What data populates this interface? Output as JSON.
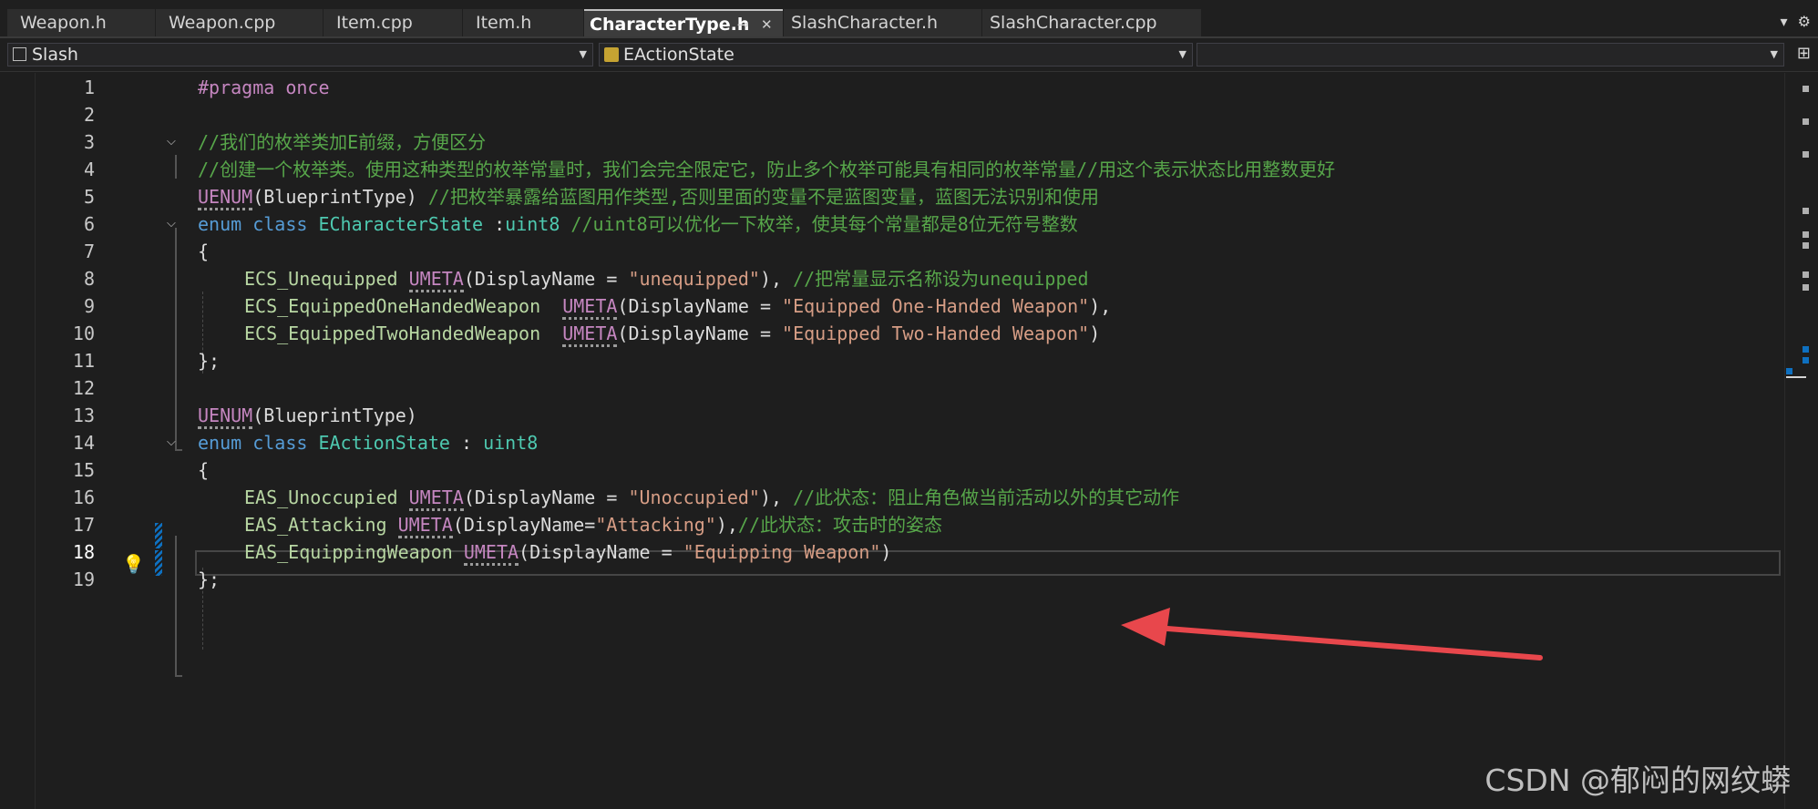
{
  "tabs": [
    {
      "label": "Weapon.h",
      "active": false
    },
    {
      "label": "Weapon.cpp",
      "active": false
    },
    {
      "label": "Item.cpp",
      "active": false
    },
    {
      "label": "Item.h",
      "active": false
    },
    {
      "label": "CharacterType.h",
      "active": true
    },
    {
      "label": "SlashCharacter.h",
      "active": false
    },
    {
      "label": "SlashCharacter.cpp",
      "active": false
    }
  ],
  "navbar": {
    "project": "Slash",
    "scope": "EActionState",
    "member": ""
  },
  "editor": {
    "current_line": 18,
    "line_numbers": [
      "1",
      "2",
      "3",
      "4",
      "5",
      "6",
      "7",
      "8",
      "9",
      "10",
      "11",
      "12",
      "13",
      "14",
      "15",
      "16",
      "17",
      "18",
      "19"
    ],
    "lines": {
      "l1": {
        "a": "#pragma once"
      },
      "l3": {
        "a": "//我们的枚举类加E前缀，方便区分"
      },
      "l4": {
        "a": "//创建一个枚举类。使用这种类型的枚举常量时，我们会完全限定它，防止多个枚举可能具有相同的枚举常量//用这个表示状态比用整数更好"
      },
      "l5": {
        "a": "UENUM",
        "b": "(BlueprintType) ",
        "c": "//把枚举暴露给蓝图用作类型,否则里面的变量不是蓝图变量，蓝图无法识别和使用"
      },
      "l6": {
        "a": "enum class ",
        "b": "ECharacterState",
        "c": " :",
        "d": "uint8",
        "e": " //uint8可以优化一下枚举，使其每个常量都是8位无符号整数"
      },
      "l7": {
        "a": "{"
      },
      "l8": {
        "a": "ECS_Unequipped",
        "b": " ",
        "c": "UMETA",
        "d": "(DisplayName = ",
        "e": "\"unequipped\"",
        "f": "), ",
        "g": "//把常量显示名称设为unequipped"
      },
      "l9": {
        "a": "ECS_EquippedOneHandedWeapon",
        "b": "  ",
        "c": "UMETA",
        "d": "(DisplayName = ",
        "e": "\"Equipped One-Handed Weapon\"",
        "f": "),"
      },
      "l10": {
        "a": "ECS_EquippedTwoHandedWeapon",
        "b": "  ",
        "c": "UMETA",
        "d": "(DisplayName = ",
        "e": "\"Equipped Two-Handed Weapon\"",
        "f": ")"
      },
      "l11": {
        "a": "};"
      },
      "l13": {
        "a": "UENUM",
        "b": "(BlueprintType)"
      },
      "l14": {
        "a": "enum class ",
        "b": "EActionState",
        "c": " : ",
        "d": "uint8"
      },
      "l15": {
        "a": "{"
      },
      "l16": {
        "a": "EAS_Unoccupied",
        "b": " ",
        "c": "UMETA",
        "d": "(DisplayName = ",
        "e": "\"Unoccupied\"",
        "f": "), ",
        "g": "//此状态：阻止角色做当前活动以外的其它动作"
      },
      "l17": {
        "a": "EAS_Attacking",
        "b": " ",
        "c": "UMETA",
        "d": "(DisplayName=",
        "e": "\"Attacking\"",
        "f": "),",
        "g": "//此状态：攻击时的姿态"
      },
      "l18": {
        "a": "EAS_EquippingWeapon",
        "b": " ",
        "c": "UMETA",
        "d": "(DisplayName = ",
        "e": "\"Equipping Weapon\"",
        "f": ")"
      },
      "l19": {
        "a": "};"
      }
    }
  },
  "annotation": {
    "color": "#e8474c"
  },
  "watermark": "CSDN @郁闷的网纹蟒",
  "colors": {
    "keyword": "#569cd6",
    "type": "#4ec9b0",
    "comment": "#57a64a",
    "string": "#d69d85",
    "macro": "#c586c0",
    "enum_member": "#b8d7a3",
    "background": "#1e1e1e"
  }
}
